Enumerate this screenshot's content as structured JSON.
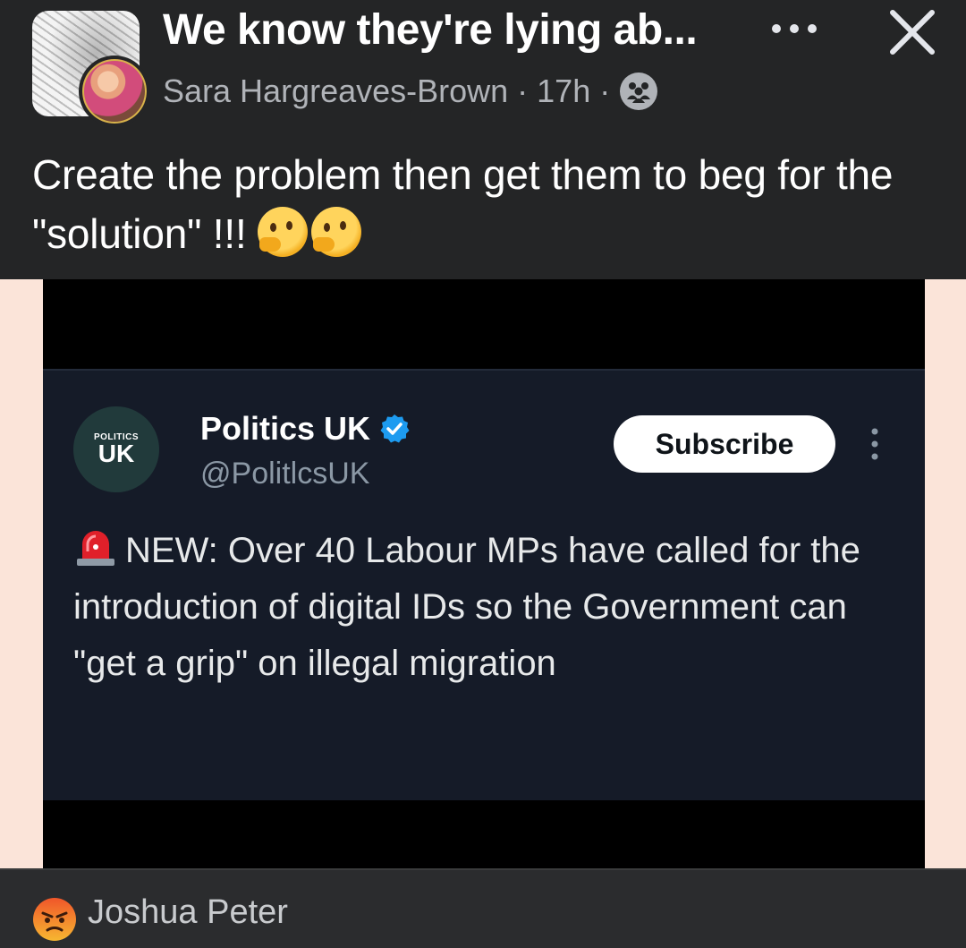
{
  "header": {
    "group_title": "We know they're lying ab...",
    "author": "Sara Hargreaves-Brown",
    "time": "17h",
    "separator": "·",
    "audience_icon": "group-audience-icon",
    "more_icon": "more-horizontal-icon",
    "close_icon": "close-icon"
  },
  "post": {
    "text": "Create the problem then get them to beg for the \"solution\" !!! ",
    "emojis": [
      "thinking-face",
      "thinking-face"
    ]
  },
  "shared_image": {
    "avatar": {
      "small_text": "POLITICS",
      "big_text": "UK"
    },
    "account_name": "Politics UK",
    "handle": "@PolitlcsUK",
    "verified_icon": "verified-badge-icon",
    "subscribe_label": "Subscribe",
    "more_icon": "more-vertical-icon",
    "siren_icon": "siren-icon",
    "tweet_text": "NEW: Over 40 Labour MPs have called for the introduction of digital IDs so the Government can \"get a grip\" on illegal migration"
  },
  "comment_preview": {
    "reaction_icon": "angry-reaction-icon",
    "commenter": "Joshua Peter"
  },
  "colors": {
    "background": "#242526",
    "tweet_card": "#151b28",
    "verified_blue": "#1d9bf0",
    "image_side_bg": "#fbe4d9"
  }
}
